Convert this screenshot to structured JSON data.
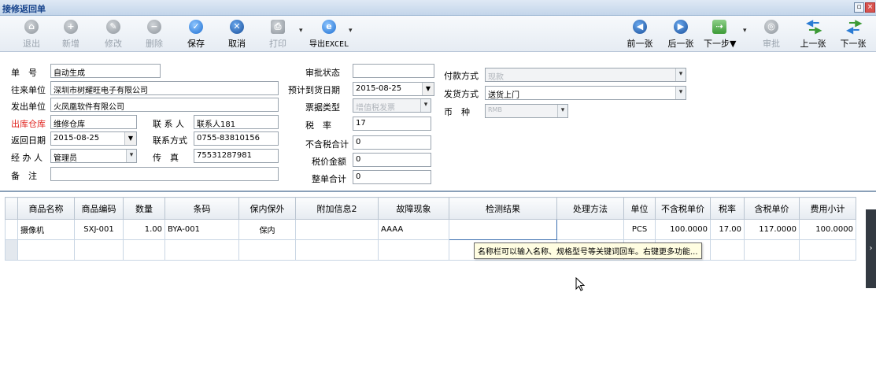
{
  "window": {
    "title": "接修返回单"
  },
  "toolbar": {
    "exit": "退出",
    "add": "新增",
    "edit": "修改",
    "delete": "删除",
    "save": "保存",
    "cancel": "取消",
    "print": "打印",
    "export": "导出EXCEL",
    "prev_doc": "前一张",
    "next_doc": "后一张",
    "next_step": "下一步▼",
    "approve": "审批",
    "prev_page": "上一张",
    "next_page": "下一张"
  },
  "form": {
    "doc_no_label": "单　号",
    "doc_no": "自动生成",
    "partner_label": "往来单位",
    "partner": "深圳市树耀旺电子有限公司",
    "sender_label": "发出单位",
    "sender": "火凤凰软件有限公司",
    "warehouse_label": "出库仓库",
    "warehouse": "维修仓库",
    "contact_label": "联 系 人",
    "contact": "联系人181",
    "return_date_label": "返回日期",
    "return_date": "2015-08-25",
    "phone_label": "联系方式",
    "phone": "0755-83810156",
    "handler_label": "经 办 人",
    "handler": "管理员",
    "fax_label": "传　真",
    "fax": "75531287981",
    "remark_label": "备　注",
    "remark": "",
    "approval_label": "审批状态",
    "approval": "",
    "arrival_label": "预计到货日期",
    "arrival": "2015-08-25",
    "invoice_label": "票据类型",
    "invoice": "增值税发票",
    "tax_rate_label": "税　率",
    "tax_rate": "17",
    "pretax_label": "不含税合计",
    "pretax": "0",
    "tax_amount_label": "税价金额",
    "tax_amount": "0",
    "total_label": "整单合计",
    "total": "0",
    "payment_label": "付款方式",
    "payment": "现款",
    "shipping_label": "发货方式",
    "shipping": "送货上门",
    "currency_label": "币　种",
    "currency": "RMB"
  },
  "table": {
    "headers": [
      "商品名称",
      "商品编码",
      "数量",
      "条码",
      "保内保外",
      "附加信息2",
      "故障现象",
      "检测结果",
      "处理方法",
      "单位",
      "不含税单价",
      "税率",
      "含税单价",
      "费用小计"
    ],
    "row1": {
      "name": "摄像机",
      "code": "SXJ-001",
      "qty": "1.00",
      "barcode": "BYA-001",
      "warranty": "保内",
      "extra": "",
      "fault": "AAAA",
      "result": "",
      "method": "",
      "unit": "PCS",
      "price": "100.0000",
      "rate": "17.00",
      "taxed_price": "117.0000",
      "subtotal": "100.0000"
    }
  },
  "tooltip": "名称栏可以输入名称、规格型号等关键词回车。右键更多功能...",
  "colors": {
    "required_label": "#e0201b",
    "title_text": "#15428b"
  }
}
